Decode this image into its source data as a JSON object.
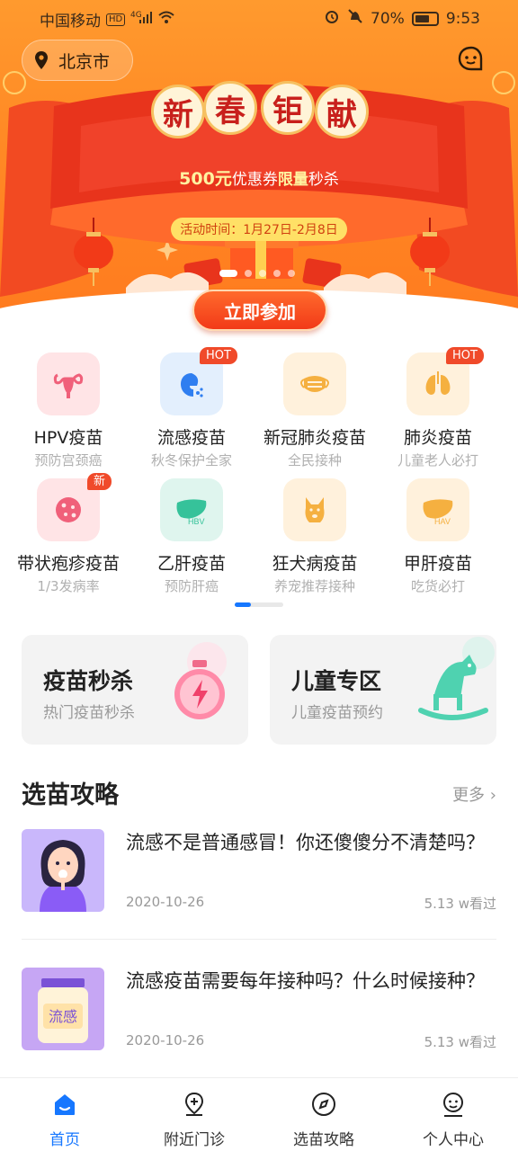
{
  "status_bar": {
    "carrier": "中国移动",
    "network": "HD",
    "signal": "4G",
    "battery": "70%",
    "time": "9:53"
  },
  "header": {
    "location": "北京市",
    "chat_icon": "chat-bubble-icon"
  },
  "banner": {
    "title_chars": [
      "新",
      "春",
      "钜",
      "献"
    ],
    "subtitle_amount": "500元",
    "subtitle_mid": "优惠券",
    "subtitle_bold": "限量",
    "subtitle_end": "秒杀",
    "activity_time": "活动时间：1月27日-2月8日",
    "join_button": "立即参加",
    "slide_count": 5,
    "active_slide": 0
  },
  "categories": [
    {
      "name": "HPV疫苗",
      "sub": "预防宫颈癌",
      "icon": "uterus-icon",
      "badge": "",
      "bg": "#ffe4e6",
      "color": "#f0607a"
    },
    {
      "name": "流感疫苗",
      "sub": "秋冬保护全家",
      "icon": "flu-sneeze-icon",
      "badge": "HOT",
      "bg": "#e3effd",
      "color": "#2f7ef0"
    },
    {
      "name": "新冠肺炎疫苗",
      "sub": "全民接种",
      "icon": "mask-icon",
      "badge": "",
      "bg": "#fff1dc",
      "color": "#f5b040"
    },
    {
      "name": "肺炎疫苗",
      "sub": "儿童老人必打",
      "icon": "lungs-icon",
      "badge": "HOT",
      "bg": "#fff1dc",
      "color": "#f5b040"
    },
    {
      "name": "带状疱疹疫苗",
      "sub": "1/3发病率",
      "icon": "virus-cell-icon",
      "badge": "新",
      "bg": "#ffe4e6",
      "color": "#f0607a"
    },
    {
      "name": "乙肝疫苗",
      "sub": "预防肝癌",
      "icon": "liver-hbv-icon",
      "badge": "",
      "bg": "#dff5ee",
      "color": "#36c29a"
    },
    {
      "name": "狂犬病疫苗",
      "sub": "养宠推荐接种",
      "icon": "dog-icon",
      "badge": "",
      "bg": "#fff1dc",
      "color": "#f5b040"
    },
    {
      "name": "甲肝疫苗",
      "sub": "吃货必打",
      "icon": "liver-hav-icon",
      "badge": "",
      "bg": "#fff1dc",
      "color": "#f5b040"
    }
  ],
  "promos": [
    {
      "title": "疫苗秒杀",
      "sub": "热门疫苗秒杀",
      "icon": "stopwatch-lightning-icon"
    },
    {
      "title": "儿童专区",
      "sub": "儿童疫苗预约",
      "icon": "rocking-horse-icon"
    }
  ],
  "guide": {
    "title": "选苗攻略",
    "more": "更多"
  },
  "articles": [
    {
      "title": "流感不是普通感冒！你还傻傻分不清楚吗？",
      "date": "2020-10-26",
      "views": "5.13 w看过",
      "thumb": "sick-girl-illustration"
    },
    {
      "title": "流感疫苗需要每年接种吗？什么时候接种？",
      "date": "2020-10-26",
      "views": "5.13 w看过",
      "thumb": "flu-jar-illustration",
      "thumb_label": "流感"
    }
  ],
  "tabs": [
    {
      "label": "首页",
      "icon": "home-icon",
      "active": true
    },
    {
      "label": "附近门诊",
      "icon": "map-pin-plus-icon",
      "active": false
    },
    {
      "label": "选苗攻略",
      "icon": "compass-icon",
      "active": false
    },
    {
      "label": "个人中心",
      "icon": "user-face-icon",
      "active": false
    }
  ],
  "colors": {
    "brand_blue": "#1677ff",
    "banner_orange": "#ff8a25",
    "banner_red": "#e8341c",
    "hot_badge": "#f04a2a"
  }
}
